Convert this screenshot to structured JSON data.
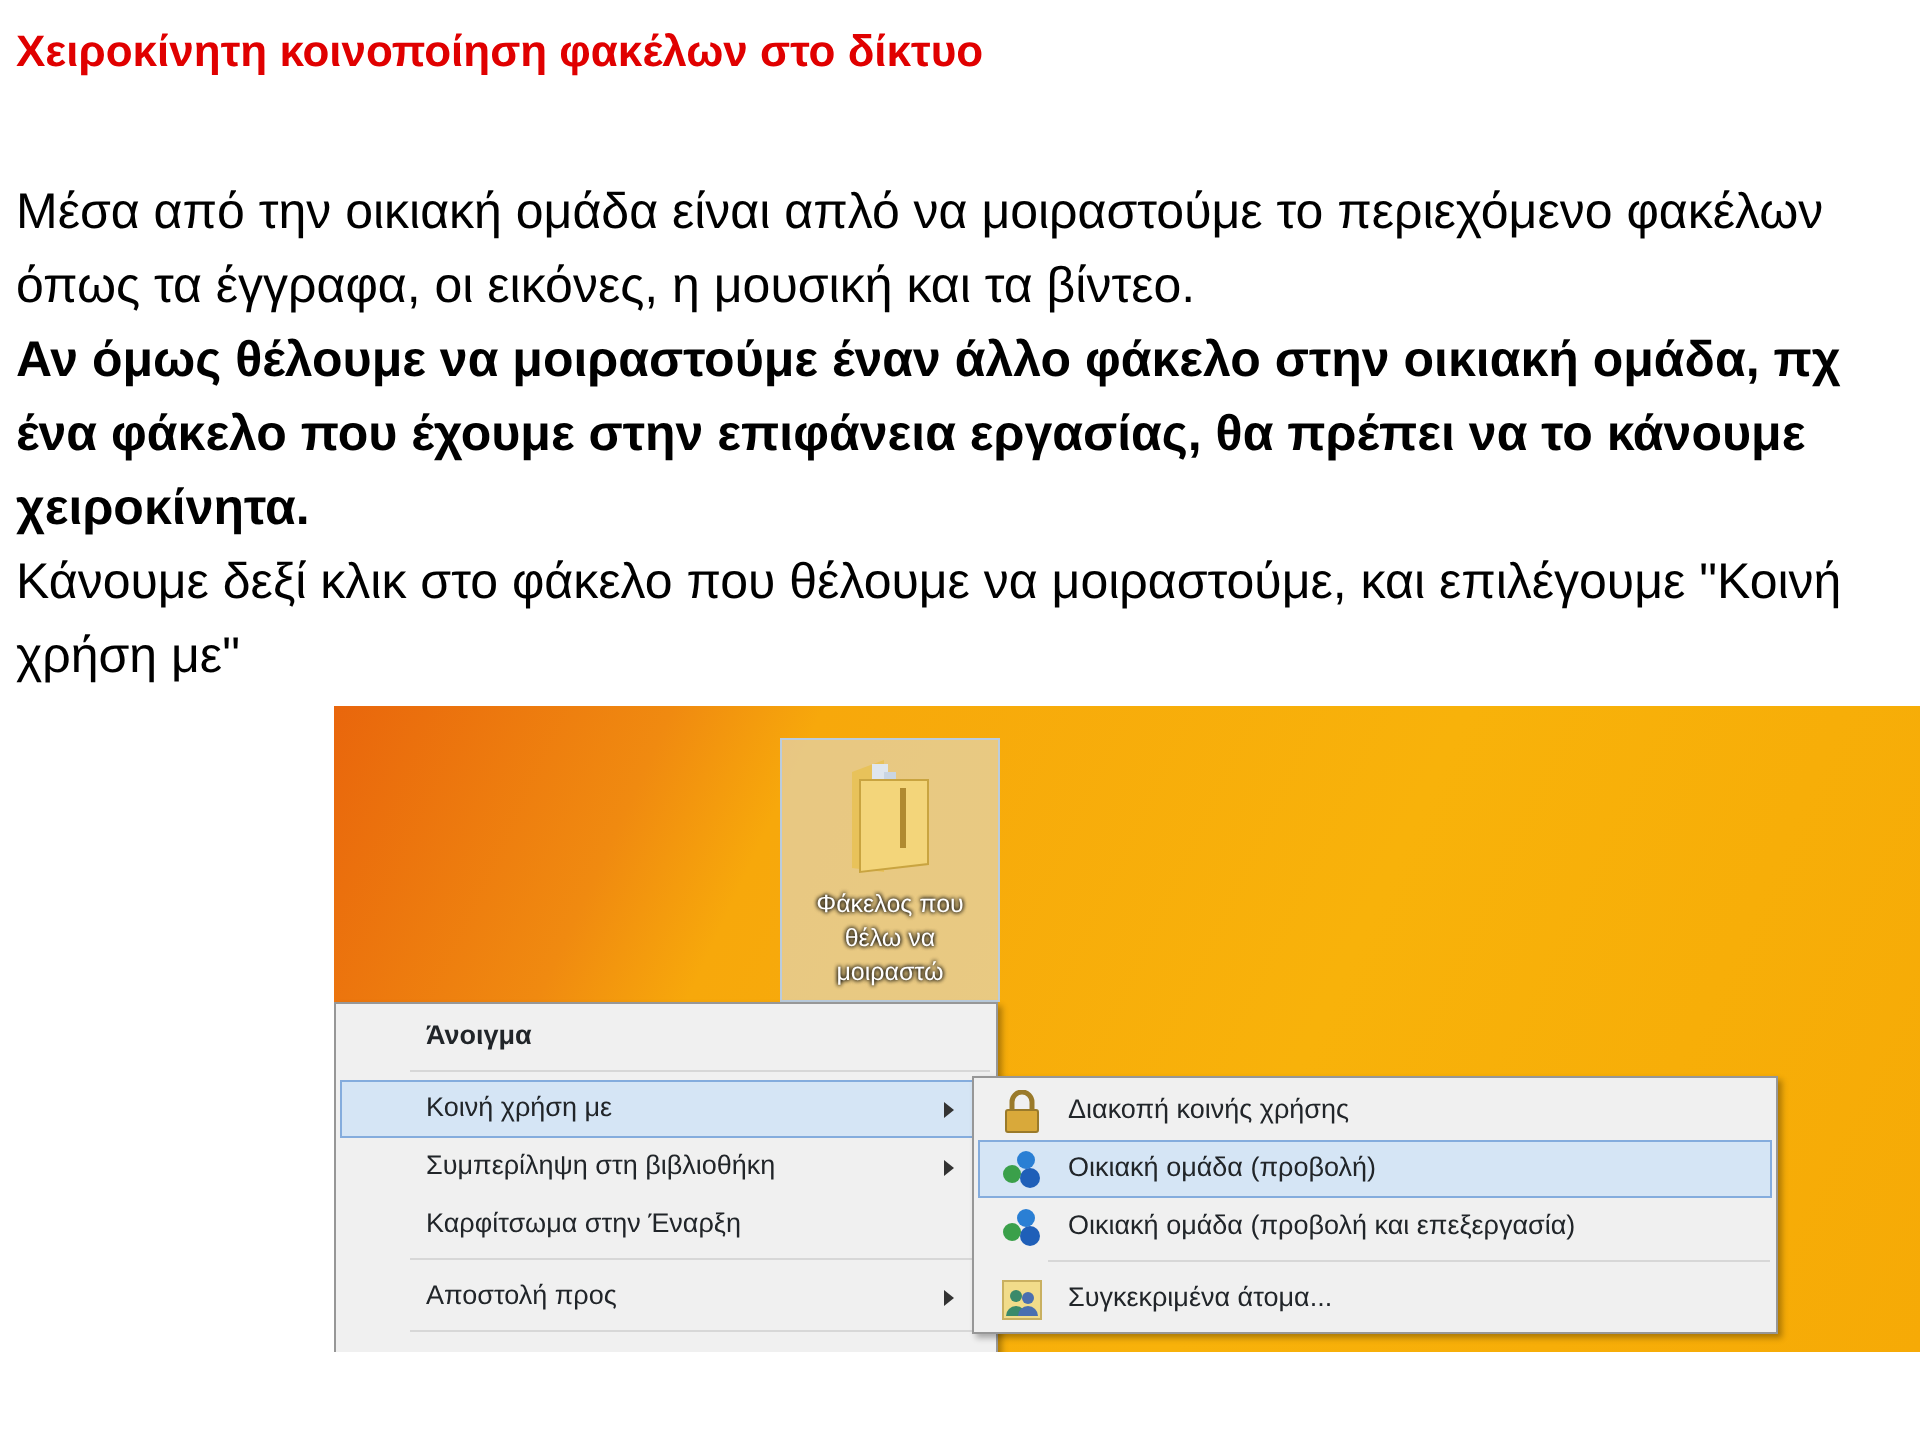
{
  "title": "Χειροκίνητη κοινοποίηση φακέλων στο δίκτυο",
  "paragraphs": [
    {
      "text": "Μέσα από την οικιακή ομάδα είναι απλό να μοιραστούμε το περιεχόμενο φακέλων όπως τα έγγραφα, οι εικόνες, η μουσική και τα βίντεο.",
      "bold": false
    },
    {
      "text": "Αν όμως θέλουμε να μοιραστούμε έναν άλλο φάκελο στην οικιακή ομάδα, πχ ένα φάκελο που έχουμε στην επιφάνεια εργασίας, θα πρέπει να το κάνουμε χειροκίνητα.",
      "bold": true
    },
    {
      "text": "Κάνουμε δεξί κλικ στο φάκελο που θέλουμε να μοιραστούμε, και επιλέγουμε \"Κοινή χρήση με\"",
      "bold": false
    }
  ],
  "screenshot": {
    "desktop_icon": {
      "label": "Φάκελος που θέλω να μοιραστώ",
      "selected": true
    },
    "context_menu": [
      {
        "label": "Άνοιγμα",
        "bold": true,
        "selected": false,
        "submenu": false,
        "separator_after": true
      },
      {
        "label": "Κοινή χρήση με",
        "bold": false,
        "selected": true,
        "submenu": true,
        "separator_after": false
      },
      {
        "label": "Συμπερίληψη στη βιβλιοθήκη",
        "bold": false,
        "selected": false,
        "submenu": true,
        "separator_after": false
      },
      {
        "label": "Καρφίτσωμα στην Έναρξη",
        "bold": false,
        "selected": false,
        "submenu": false,
        "separator_after": true
      },
      {
        "label": "Αποστολή προς",
        "bold": false,
        "selected": false,
        "submenu": true,
        "separator_after": true
      }
    ],
    "submenu": [
      {
        "label": "Διακοπή κοινής χρήσης",
        "kind": "lock",
        "selected": false,
        "separator_after": false
      },
      {
        "label": "Οικιακή ομάδα (προβολή)",
        "kind": "homegroup",
        "selected": true,
        "separator_after": false
      },
      {
        "label": "Οικιακή ομάδα (προβολή και επεξεργασία)",
        "kind": "homegroup",
        "selected": false,
        "separator_after": true
      },
      {
        "label": "Συγκεκριμένα άτομα...",
        "kind": "people",
        "selected": false,
        "separator_after": false
      }
    ]
  }
}
